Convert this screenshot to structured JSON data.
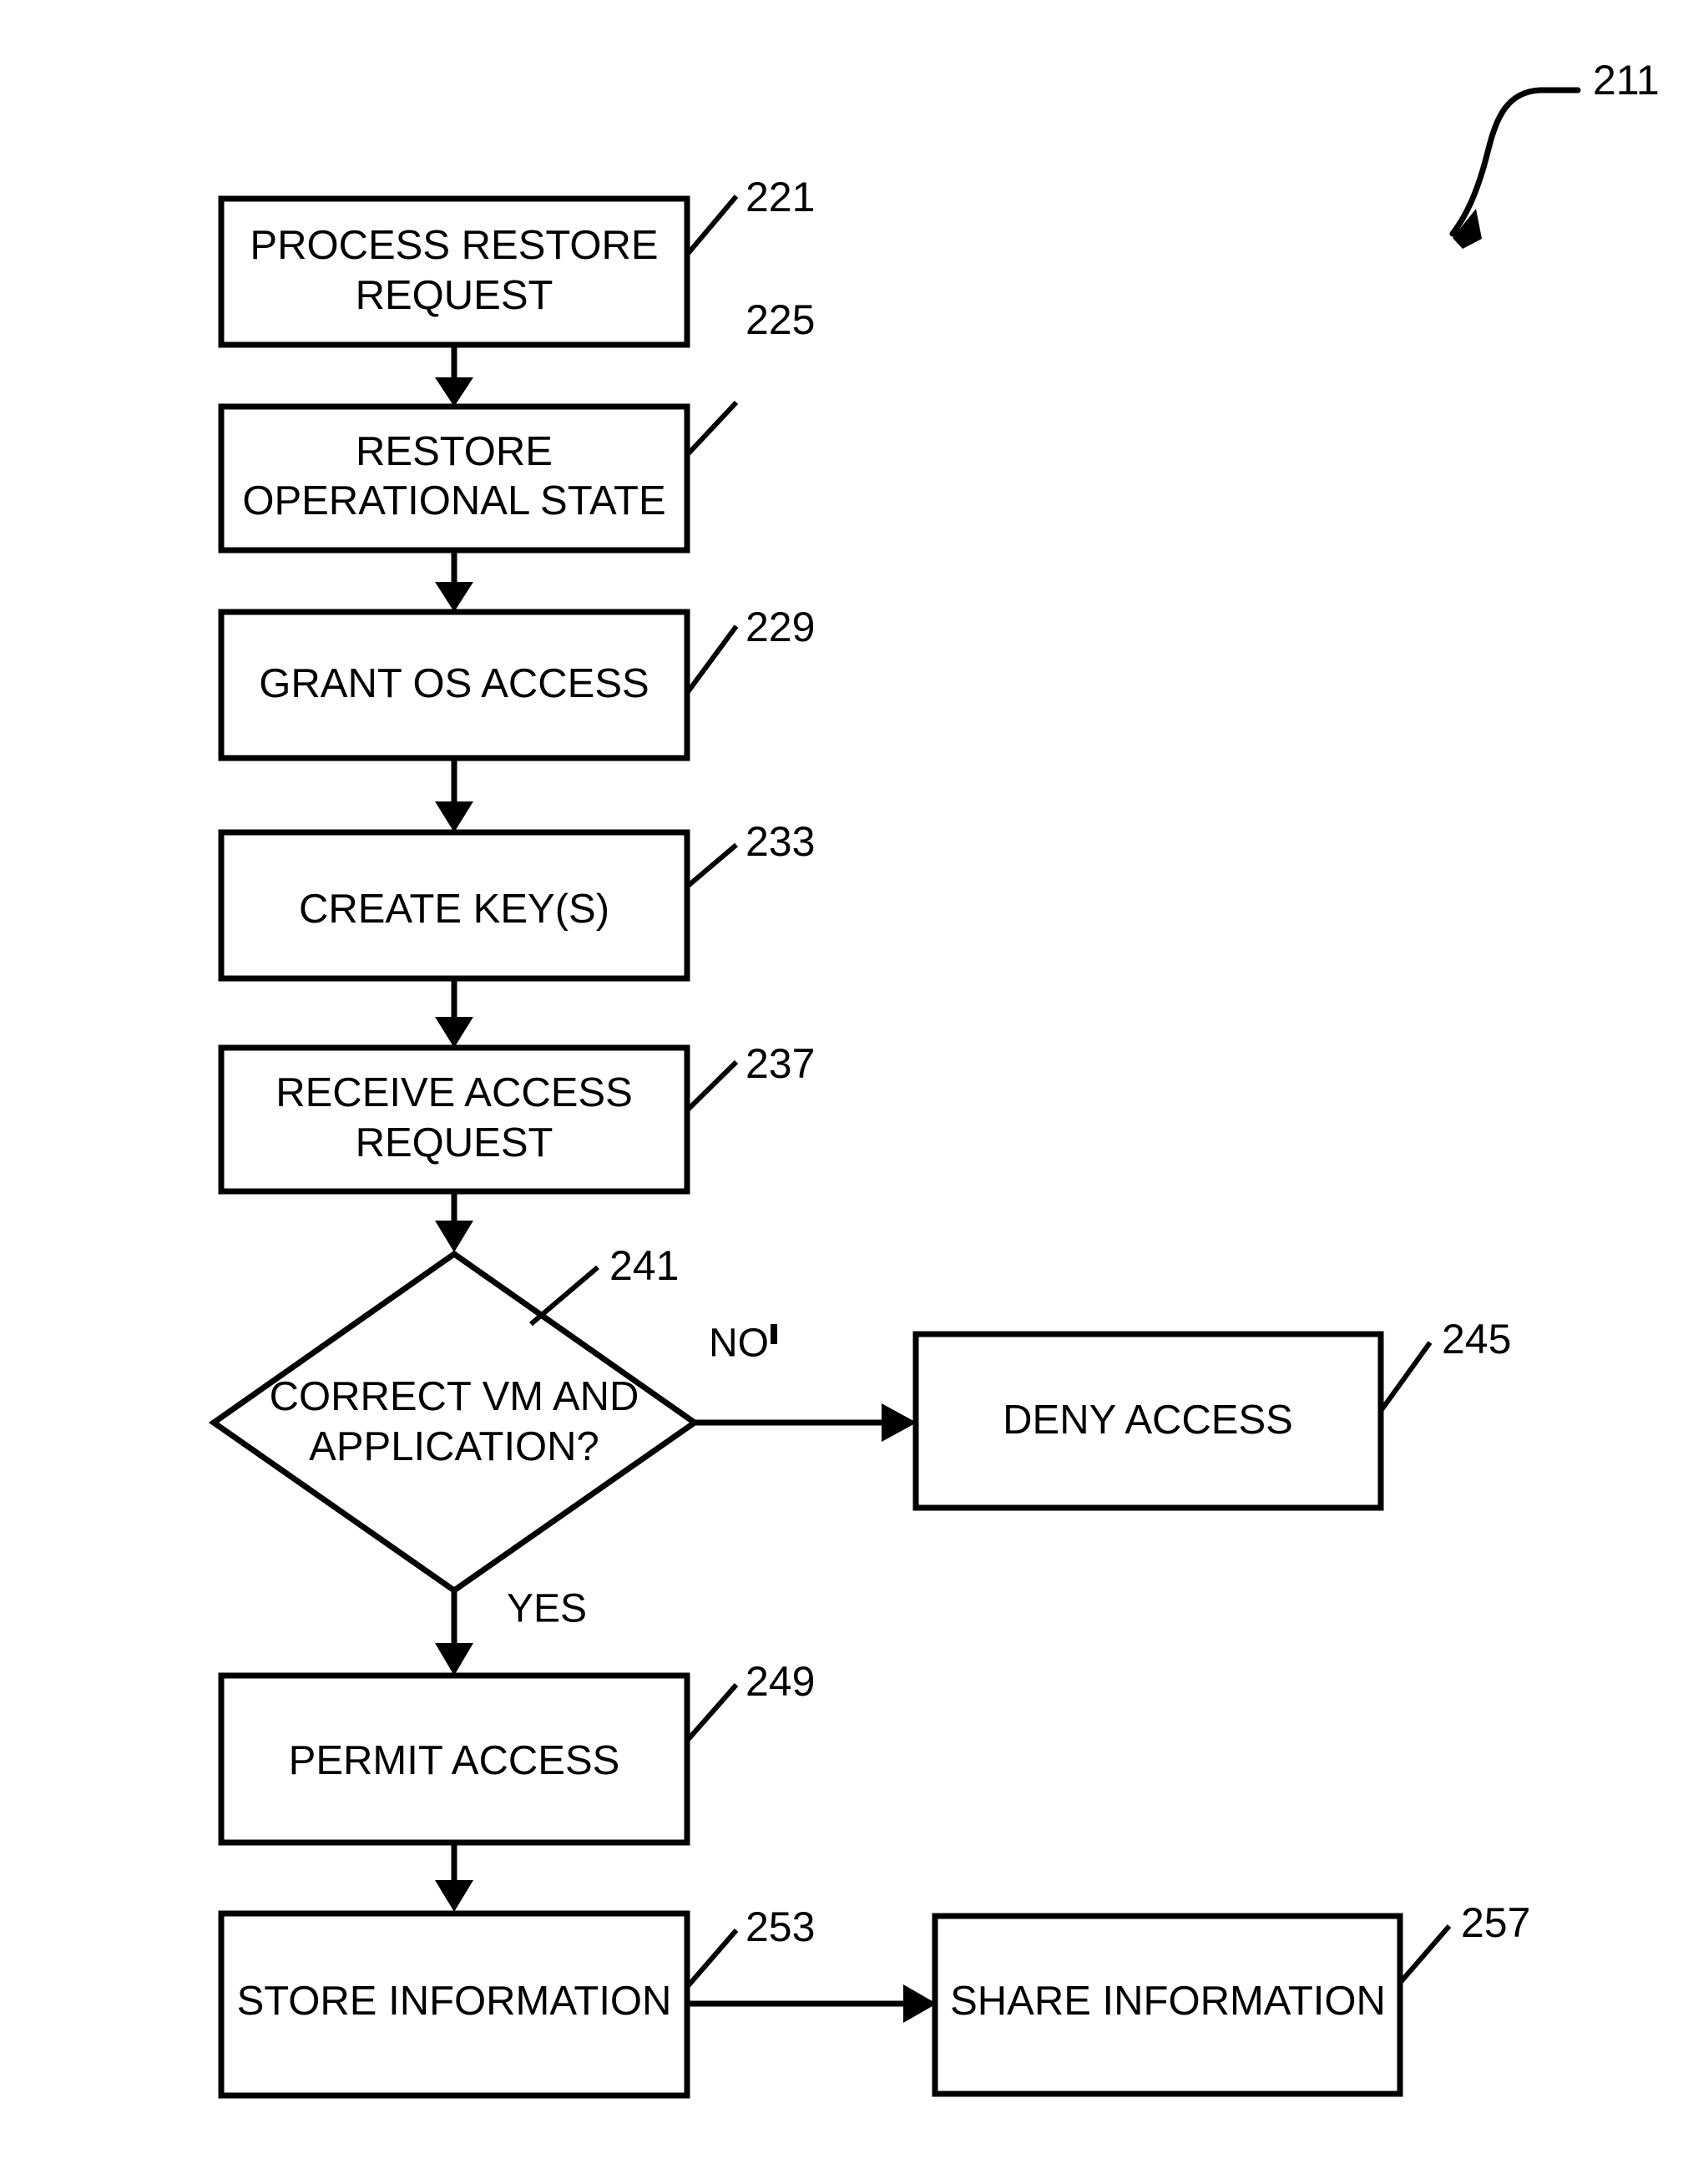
{
  "figure": {
    "figure_ref": "211",
    "title": ""
  },
  "nodes": [
    {
      "id": "process-restore-request",
      "ref": "221",
      "shape": "rect",
      "lines": [
        "PROCESS RESTORE",
        "REQUEST"
      ]
    },
    {
      "id": "restore-operational-state",
      "ref": "225",
      "shape": "rect",
      "lines": [
        "RESTORE",
        "OPERATIONAL STATE"
      ]
    },
    {
      "id": "grant-os-access",
      "ref": "229",
      "shape": "rect",
      "lines": [
        "GRANT OS ACCESS"
      ]
    },
    {
      "id": "create-keys",
      "ref": "233",
      "shape": "rect",
      "lines": [
        "CREATE KEY(S)"
      ]
    },
    {
      "id": "receive-access-request",
      "ref": "237",
      "shape": "rect",
      "lines": [
        "RECEIVE ACCESS",
        "REQUEST"
      ]
    },
    {
      "id": "correct-vm-and-application",
      "ref": "241",
      "shape": "diamond",
      "lines": [
        "CORRECT VM AND",
        "APPLICATION?"
      ]
    },
    {
      "id": "deny-access",
      "ref": "245",
      "shape": "rect",
      "lines": [
        "DENY ACCESS"
      ]
    },
    {
      "id": "permit-access",
      "ref": "249",
      "shape": "rect",
      "lines": [
        "PERMIT ACCESS"
      ]
    },
    {
      "id": "store-information",
      "ref": "253",
      "shape": "rect",
      "lines": [
        "STORE INFORMATION"
      ]
    },
    {
      "id": "share-information",
      "ref": "257",
      "shape": "rect",
      "lines": [
        "SHARE INFORMATION"
      ]
    }
  ],
  "branch_labels": {
    "no": "NO",
    "yes": "YES"
  },
  "colors": {
    "stroke": "#000000",
    "fill": "#ffffff",
    "background": "#ffffff"
  }
}
